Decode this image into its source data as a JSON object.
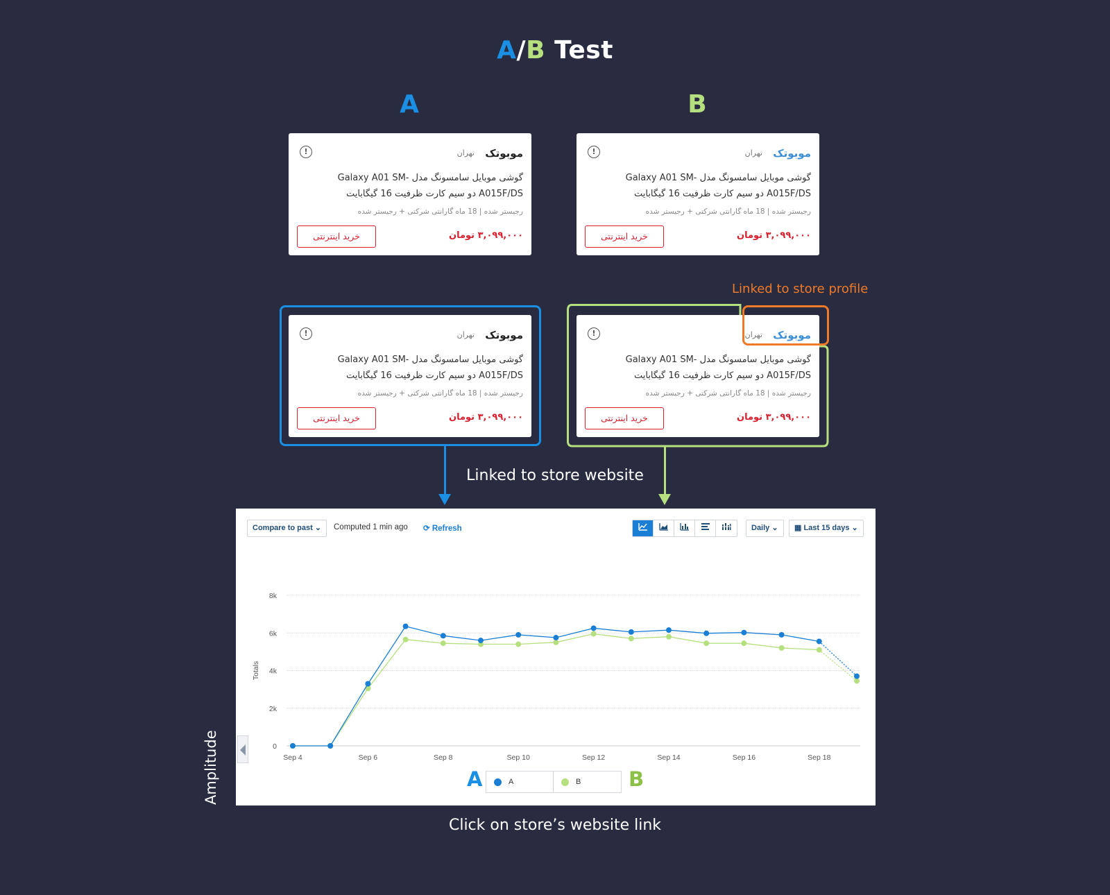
{
  "title": {
    "a": "A",
    "sep": "/",
    "b": "B",
    "rest": " Test"
  },
  "column_labels": {
    "a": "A",
    "b": "B"
  },
  "card": {
    "shop": "موبوتک",
    "city": "تهران",
    "info_icon": "!",
    "desc": "گوشی موبایل سامسونگ مدل Galaxy A01 SM-A015F/DS دو سیم کارت ظرفیت 16 گیگابایت",
    "warranty": "رجیستر شده | 18 ماه گارانتی شرکتی + رجیستر شده",
    "price": "۳,۰۹۹,۰۰۰ تومان",
    "buy": "خرید اینترنتی"
  },
  "notes": {
    "profile": "Linked to store profile",
    "website": "Linked to store website",
    "click": "Click on store’s website link",
    "amplitude": "Amplitude"
  },
  "colors": {
    "a": "#1a8fe3",
    "b": "#b6e07f",
    "orange": "#f07a28",
    "price": "#d8202f"
  },
  "toolbar": {
    "compare": "Compare to past ⌄",
    "computed": "Computed 1 min ago",
    "refresh": "⟳ Refresh",
    "views": [
      "line-chart-icon",
      "area-chart-icon",
      "bar-chart-icon",
      "horizontal-bar-icon",
      "stacked-bar-icon"
    ],
    "interval": "Daily ⌄",
    "range": "▦ Last 15 days ⌄"
  },
  "legend": {
    "a_letter": "A",
    "b_letter": "B",
    "a": "A",
    "b": "B"
  },
  "chart_data": {
    "type": "line",
    "ylabel": "Totals",
    "ylim": [
      0,
      8000
    ],
    "yticks": [
      0,
      2000,
      4000,
      6000,
      8000
    ],
    "ytick_labels": [
      "0",
      "2k",
      "4k",
      "6k",
      "8k"
    ],
    "x": [
      "Sep 4",
      "Sep 5",
      "Sep 6",
      "Sep 7",
      "Sep 8",
      "Sep 9",
      "Sep 10",
      "Sep 11",
      "Sep 12",
      "Sep 13",
      "Sep 14",
      "Sep 15",
      "Sep 16",
      "Sep 17",
      "Sep 18",
      "Sep 19"
    ],
    "xtick_labels": [
      "Sep 4",
      "Sep 6",
      "Sep 8",
      "Sep 10",
      "Sep 12",
      "Sep 14",
      "Sep 16",
      "Sep 18"
    ],
    "series": [
      {
        "name": "A",
        "color": "#1a7fd4",
        "values": [
          0,
          0,
          3300,
          6350,
          5850,
          5600,
          5900,
          5750,
          6250,
          6050,
          6150,
          5980,
          6020,
          5900,
          5550,
          3700
        ]
      },
      {
        "name": "B",
        "color": "#b6e07f",
        "values": [
          0,
          0,
          3050,
          5650,
          5450,
          5400,
          5400,
          5500,
          5950,
          5700,
          5800,
          5450,
          5450,
          5200,
          5100,
          3450
        ]
      }
    ],
    "partial_last_point": true,
    "grid": true
  }
}
